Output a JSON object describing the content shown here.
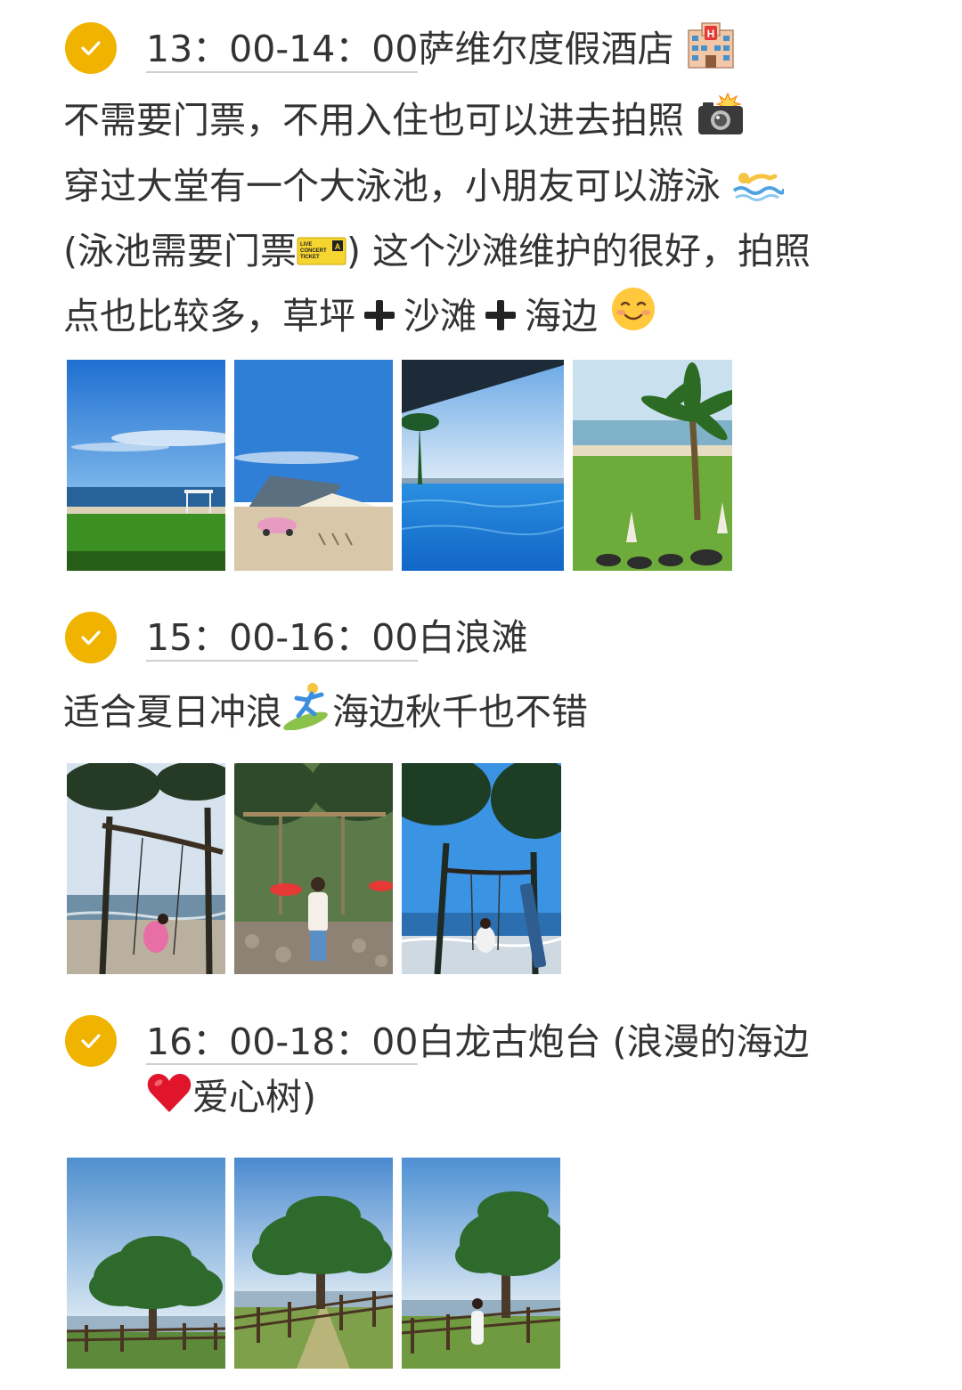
{
  "sections": [
    {
      "time": "13：00-14：00",
      "place": "萨维尔度假酒店",
      "place_icon": "hotel-icon",
      "lines": [
        "不需要门票，不用入住也可以进去拍照",
        "穿过大堂有一个大泳池，小朋友可以游泳",
        "(泳池需要门票",
        ") 这个沙滩维护的很好，拍照",
        "点也比较多，草坪",
        "沙滩",
        "海边"
      ],
      "icons": [
        "camera-flash-icon",
        "swimmer-icon",
        "ticket-icon",
        "plus-icon",
        "smiling-face-icon"
      ],
      "ticket_text": [
        "LIVE",
        "CONCERT",
        "TICKET",
        "A"
      ],
      "photos": [
        "beach-grass-shelter-photo",
        "camping-tent-beetle-car-photo",
        "infinity-pool-photo",
        "lawn-palm-tree-photo"
      ]
    },
    {
      "time": "15：00-16：00",
      "place": "白浪滩",
      "lines": [
        "适合夏日冲浪",
        "海边秋千也不错"
      ],
      "icons": [
        "surfer-icon"
      ],
      "photos": [
        "swing-sea-photo",
        "swing-stone-wall-photo",
        "swing-blue-sky-photo"
      ]
    },
    {
      "time": "16：00-18：00",
      "place": "白龙古炮台 (浪漫的海边",
      "place_line2": "爱心树)",
      "icons": [
        "red-heart-icon"
      ],
      "photos": [
        "heart-tree-photo-1",
        "heart-tree-photo-2",
        "heart-tree-photo-3"
      ]
    }
  ],
  "colors": {
    "check": "#f0b400",
    "text": "#333333",
    "sky": "#2f7fd6",
    "sea": "#1f6fbf",
    "grass": "#4a9a2a"
  }
}
